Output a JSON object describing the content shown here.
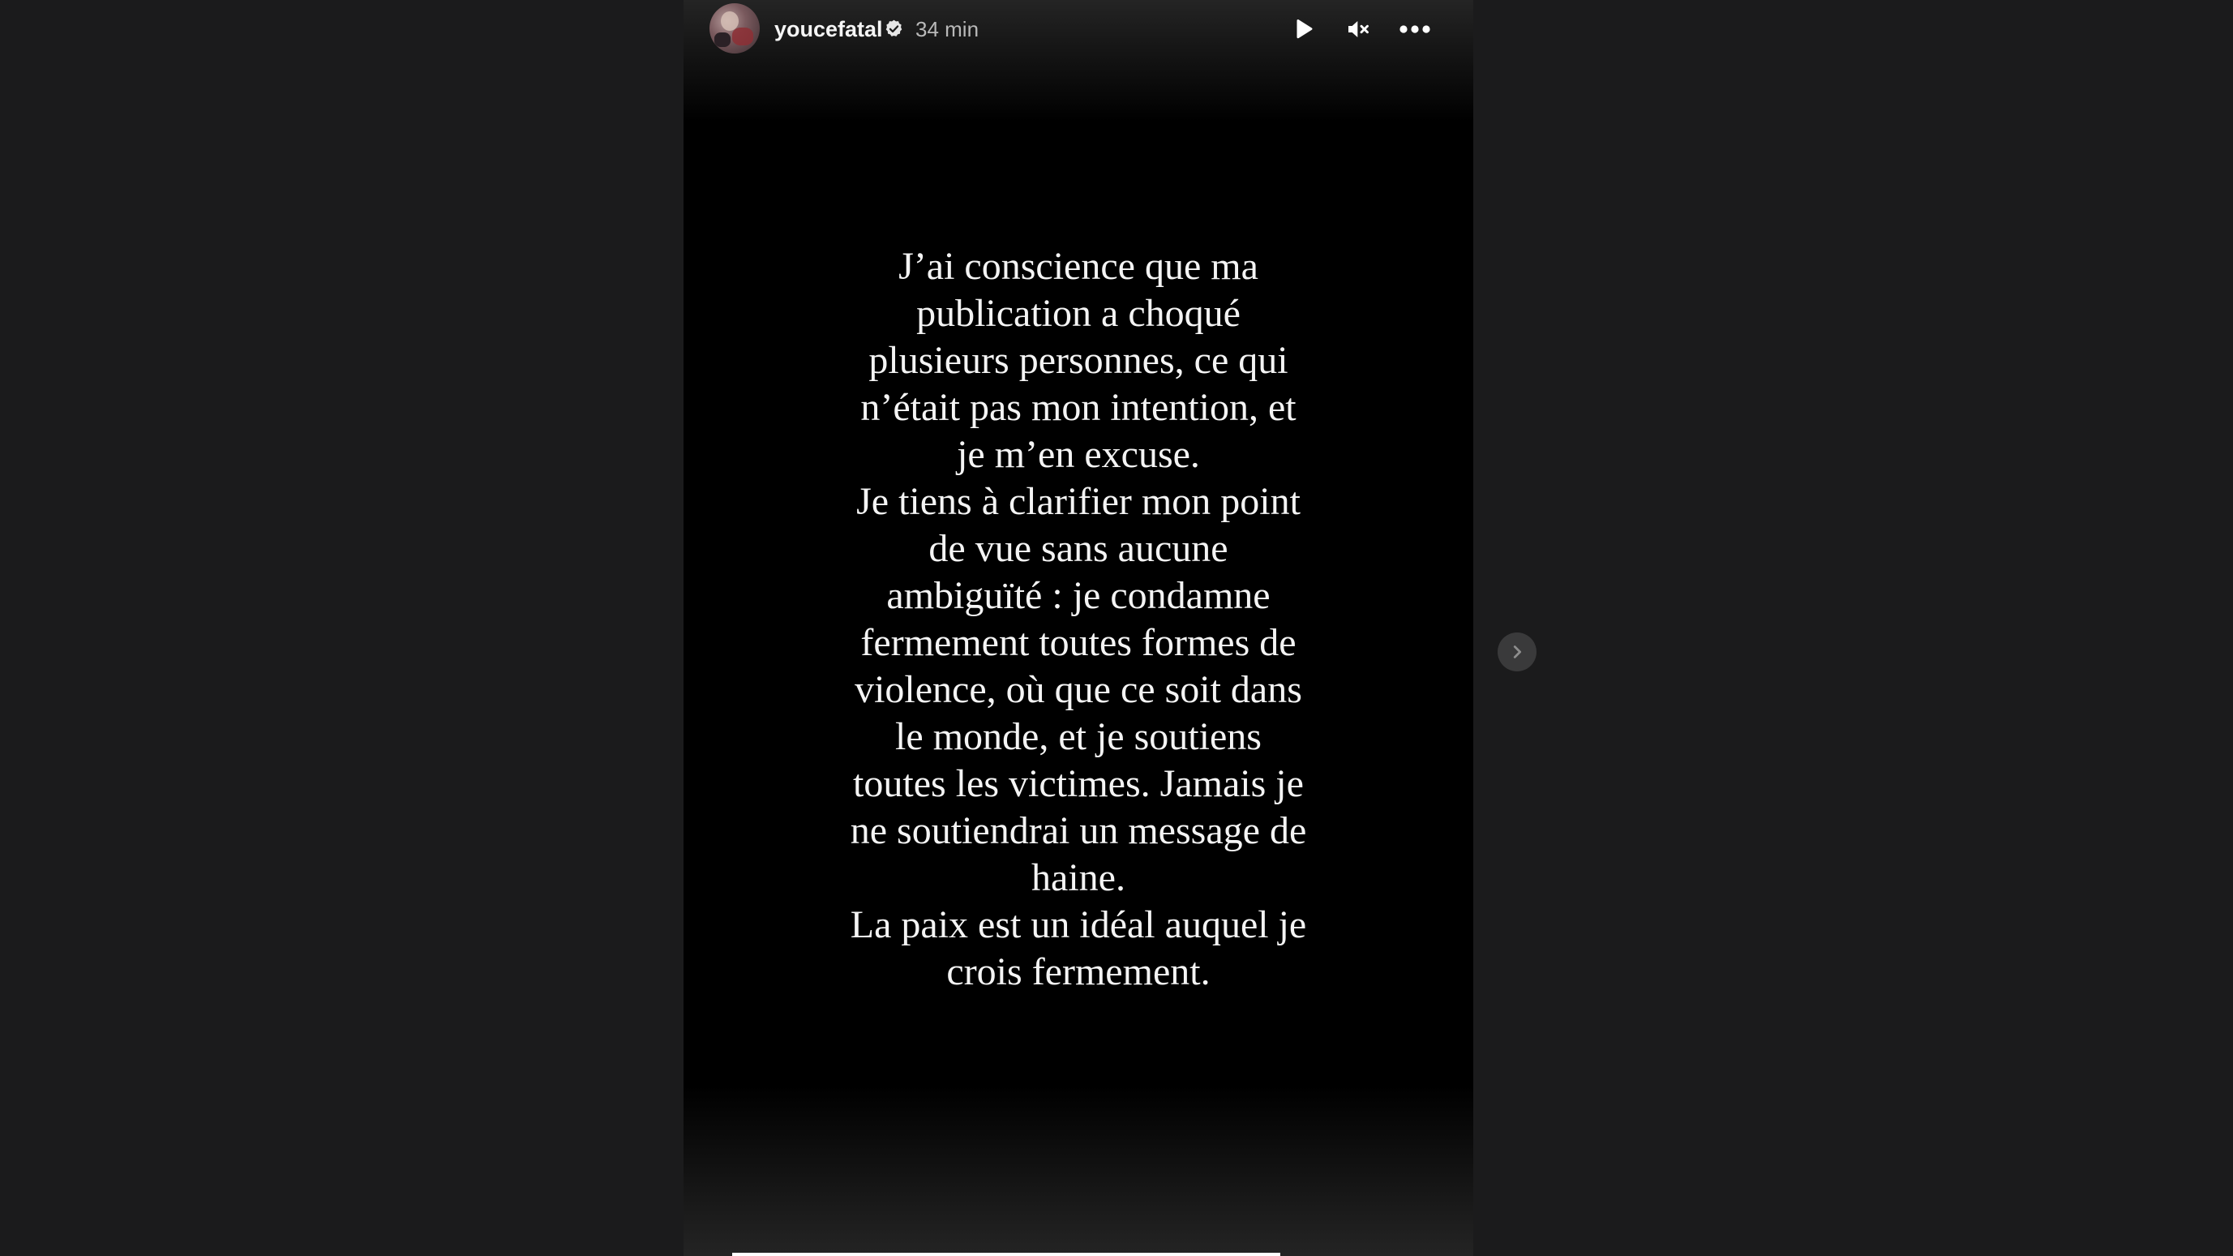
{
  "story": {
    "username": "youcefatal",
    "verified": true,
    "timestamp": "34 min",
    "text": "J’ai conscience que ma\npublication a choqué\nplusieurs personnes, ce qui\nn’était pas mon intention, et\nje m’en excuse.\nJe tiens à clarifier mon point\nde vue sans aucune\nambiguïté : je condamne\nfermement toutes formes de\nviolence, où que ce soit dans\nle monde, et je soutiens\ntoutes les victimes. Jamais je\nne soutiendrai un message de\nhaine.\nLa paix est un idéal auquel je\ncrois fermement.",
    "progress": 1.0
  },
  "icons": {
    "verified": "verified-badge-icon",
    "play": "play-icon",
    "mute": "muted-speaker-icon",
    "more": "more-options-icon",
    "next": "chevron-right-icon"
  },
  "colors": {
    "page_background": "#1b1b1c",
    "story_background": "#000000",
    "text": "#f4f4f4",
    "secondary_text": "#b9b9b9",
    "nav_button": "#3a3a3b"
  }
}
